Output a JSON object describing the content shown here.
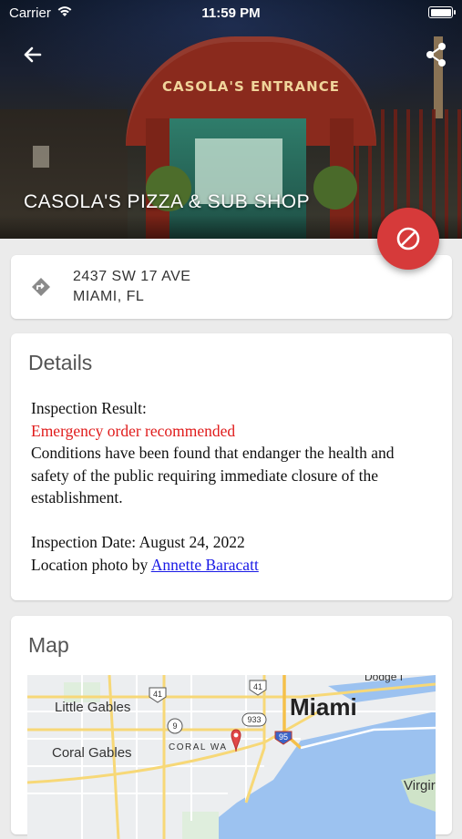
{
  "status_bar": {
    "carrier": "Carrier",
    "time": "11:59 PM"
  },
  "header": {
    "back_icon": "arrow-left-icon",
    "share_icon": "share-icon",
    "title": "CASOLA'S PIZZA & SUB SHOP",
    "photo_sign_text": "CASOLA'S ENTRANCE",
    "fab_icon": "block-icon",
    "fab_color": "#d63a3a"
  },
  "address": {
    "icon": "directions-icon",
    "line1": "2437 SW 17 AVE",
    "line2": "MIAMI, FL"
  },
  "details": {
    "heading": "Details",
    "result_label": "Inspection Result:",
    "result_value": "Emergency order recommended",
    "result_color": "#e01b1b",
    "description": "Conditions have been found that endanger the health and safety of the public requiring immediate closure of the establishment.",
    "date_line": "Inspection Date: August 24, 2022",
    "photo_prefix": "Location photo by ",
    "photo_author": "Annette Baracatt"
  },
  "map": {
    "heading": "Map",
    "labels": {
      "little_gables": "Little Gables",
      "coral_gables": "Coral Gables",
      "coral_way": "CORAL WA",
      "miami": "Miami",
      "virginia": "Virgir",
      "dodge": "Dodge I",
      "route_41a": "41",
      "route_41b": "41",
      "route_9": "9",
      "route_933": "933",
      "route_95": "95"
    },
    "pin_icon": "map-pin-icon"
  }
}
